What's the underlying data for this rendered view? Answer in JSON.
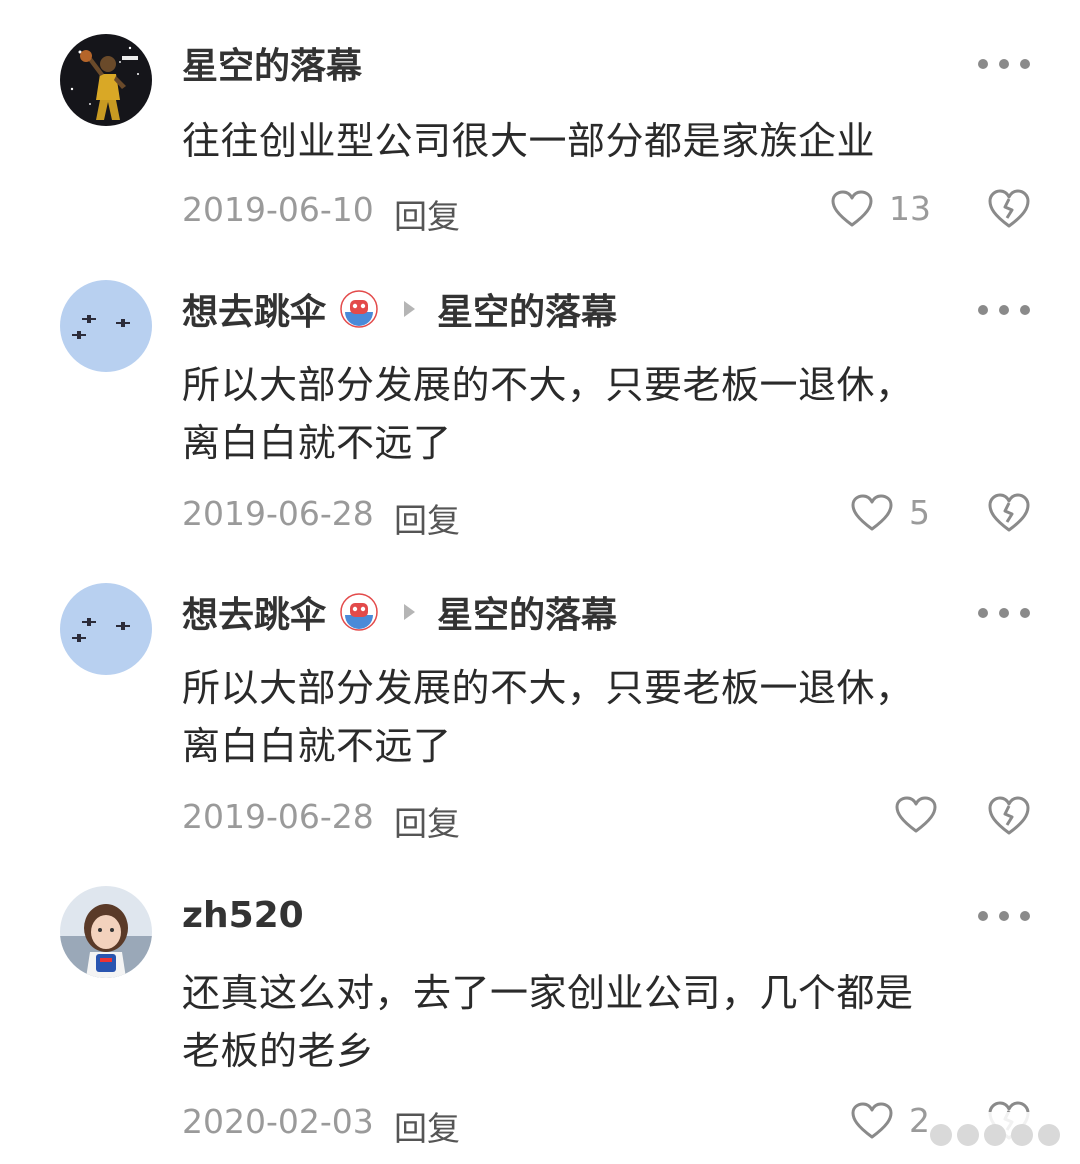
{
  "comments": [
    {
      "username": "星空的落幕",
      "reply_to": "",
      "text": "往往创业型公司很大一部分都是家族企业",
      "date": "2019-06-10",
      "reply_label": "回复",
      "likes": "13",
      "avatar": "dark-photo-avatar",
      "has_badge": false
    },
    {
      "username": "想去跳伞",
      "reply_to": "星空的落幕",
      "text": "所以大部分发展的不大，只要老板一退休，\n离白白就不远了",
      "date": "2019-06-28",
      "reply_label": "回复",
      "likes": "5",
      "avatar": "sky-jets-avatar",
      "has_badge": true
    },
    {
      "username": "想去跳伞",
      "reply_to": "星空的落幕",
      "text": "所以大部分发展的不大，只要老板一退休，\n离白白就不远了",
      "date": "2019-06-28",
      "reply_label": "回复",
      "likes": "",
      "avatar": "sky-jets-avatar",
      "has_badge": true
    },
    {
      "username": "zh520",
      "reply_to": "",
      "text": "还真这么对，去了一家创业公司，几个都是\n老板的老乡",
      "date": "2020-02-03",
      "reply_label": "回复",
      "likes": "2",
      "avatar": "child-photo-avatar",
      "has_badge": false
    }
  ],
  "icons": {
    "like": "heart-outline-icon",
    "dislike": "broken-heart-icon",
    "more": "more-dots-icon",
    "badge": "red-mascot-badge-icon"
  },
  "colors": {
    "text": "#2a2a2a",
    "meta": "#9a9a9a",
    "icon": "#8a8a8a"
  }
}
